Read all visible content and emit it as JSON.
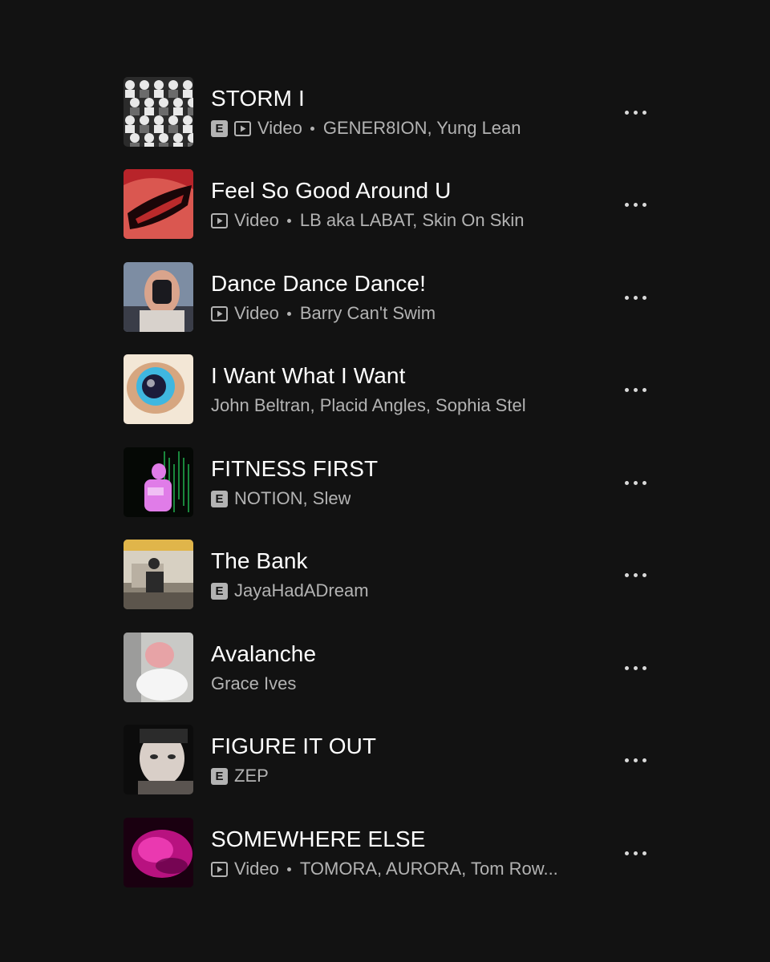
{
  "tracks": [
    {
      "title": "STORM I",
      "explicit": true,
      "video": true,
      "video_label": "Video",
      "artists": "GENER8ION, Yung Lean",
      "explicit_label": "E",
      "cover": {
        "bg": "#2b2b2b",
        "a": "#e8e8e8",
        "b": "#6b6b6b",
        "c": "#1a1a1a"
      }
    },
    {
      "title": "Feel So Good Around U",
      "explicit": false,
      "video": true,
      "video_label": "Video",
      "artists": "LB aka LABAT, Skin On Skin",
      "cover": {
        "bg": "#b8242a",
        "a": "#f07a6a",
        "b": "#1a0608",
        "c": "#ff3a3a"
      }
    },
    {
      "title": "Dance Dance Dance!",
      "explicit": false,
      "video": true,
      "video_label": "Video",
      "artists": "Barry Can't Swim",
      "cover": {
        "bg": "#7d8da3",
        "a": "#d9a48c",
        "b": "#1a1a1f",
        "c": "#3a3d48"
      }
    },
    {
      "title": "I Want What I Want",
      "explicit": false,
      "video": false,
      "artists": "John Beltran, Placid Angles, Sophia Stel",
      "cover": {
        "bg": "#f3e7d6",
        "a": "#c98a5b",
        "b": "#1c1c3a",
        "c": "#3fb7e0"
      }
    },
    {
      "title": "FITNESS FIRST",
      "explicit": true,
      "video": false,
      "artists": "NOTION, Slew",
      "explicit_label": "E",
      "cover": {
        "bg": "#050805",
        "a": "#e07ce8",
        "b": "#1fa84a",
        "c": "#ffffff"
      }
    },
    {
      "title": "The Bank",
      "explicit": true,
      "video": false,
      "artists": "JayaHadADream",
      "explicit_label": "E",
      "cover": {
        "bg": "#8a8275",
        "a": "#d7d0c2",
        "b": "#2a2a2a",
        "c": "#e0b54a"
      }
    },
    {
      "title": "Avalanche",
      "explicit": false,
      "video": false,
      "artists": "Grace Ives",
      "cover": {
        "bg": "#c9c9c6",
        "a": "#e7a3a6",
        "b": "#f5f5f5",
        "c": "#6f6f6f"
      }
    },
    {
      "title": "FIGURE IT OUT",
      "explicit": true,
      "video": false,
      "artists": "ZEP",
      "explicit_label": "E",
      "cover": {
        "bg": "#0c0c0c",
        "a": "#d9cfc8",
        "b": "#2b2b2b",
        "c": "#5a5450"
      }
    },
    {
      "title": "SOMEWHERE ELSE",
      "explicit": false,
      "video": true,
      "video_label": "Video",
      "artists": "TOMORA, AURORA, Tom Row...",
      "cover": {
        "bg": "#1a0010",
        "a": "#e0169c",
        "b": "#ff4ac4",
        "c": "#5a0040"
      }
    }
  ]
}
